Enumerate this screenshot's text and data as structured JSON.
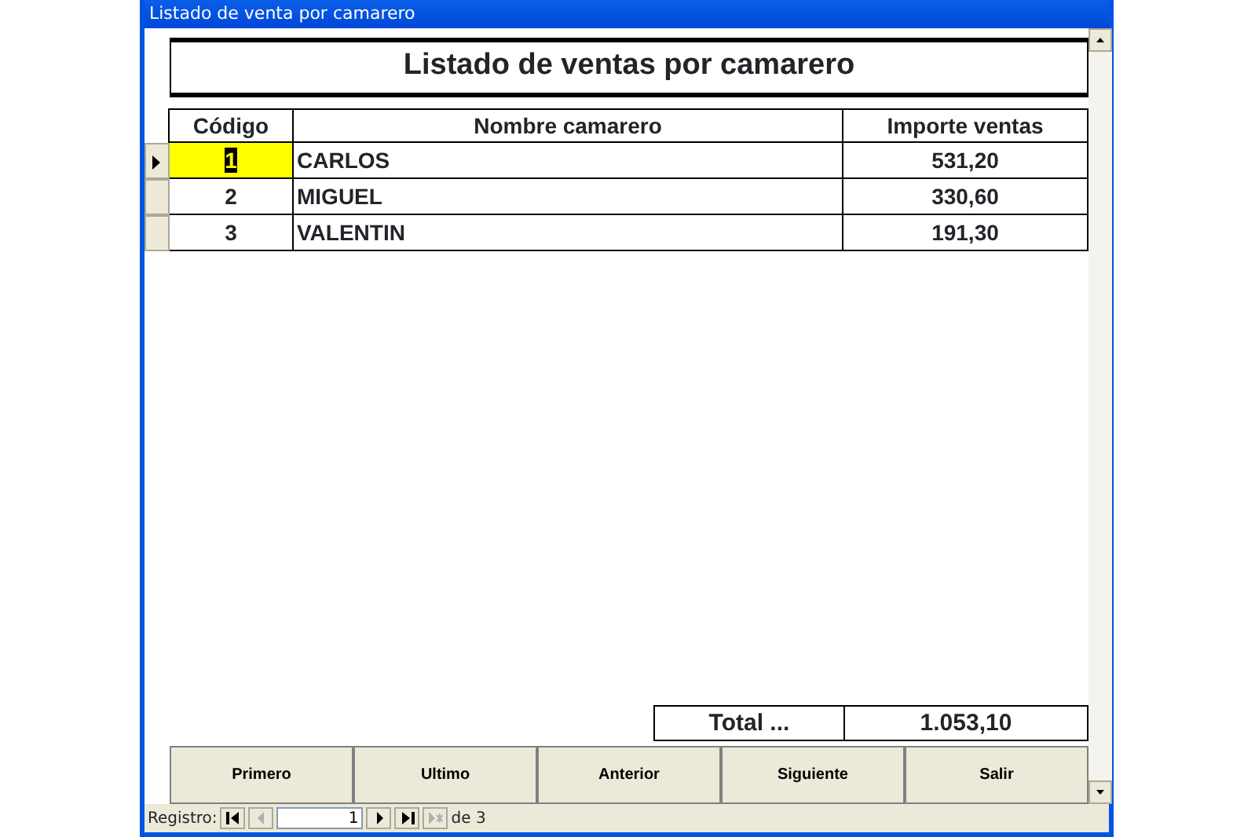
{
  "window": {
    "title": "Listado de venta por camarero"
  },
  "report_title": "Listado de ventas por camarero",
  "table": {
    "columns": [
      "Código",
      "Nombre camarero",
      "Importe ventas"
    ],
    "rows": [
      {
        "codigo": "1",
        "nombre": "CARLOS",
        "importe": "531,20",
        "selected": true
      },
      {
        "codigo": "2",
        "nombre": "MIGUEL",
        "importe": "330,60",
        "selected": false
      },
      {
        "codigo": "3",
        "nombre": "VALENTIN",
        "importe": "191,30",
        "selected": false
      }
    ]
  },
  "total": {
    "label": "Total ...",
    "value": "1.053,10"
  },
  "buttons": [
    {
      "label": "Primero"
    },
    {
      "label": "Ultimo"
    },
    {
      "label": "Anterior"
    },
    {
      "label": "Siguiente"
    },
    {
      "label": "Salir"
    }
  ],
  "navigator": {
    "label": "Registro:",
    "current": "1",
    "of_text": "de 3",
    "controls": [
      {
        "kind": "first",
        "disabled": false
      },
      {
        "kind": "prev",
        "disabled": true
      },
      {
        "kind": "field"
      },
      {
        "kind": "next",
        "disabled": false
      },
      {
        "kind": "last",
        "disabled": false
      },
      {
        "kind": "new",
        "disabled": true
      }
    ]
  }
}
